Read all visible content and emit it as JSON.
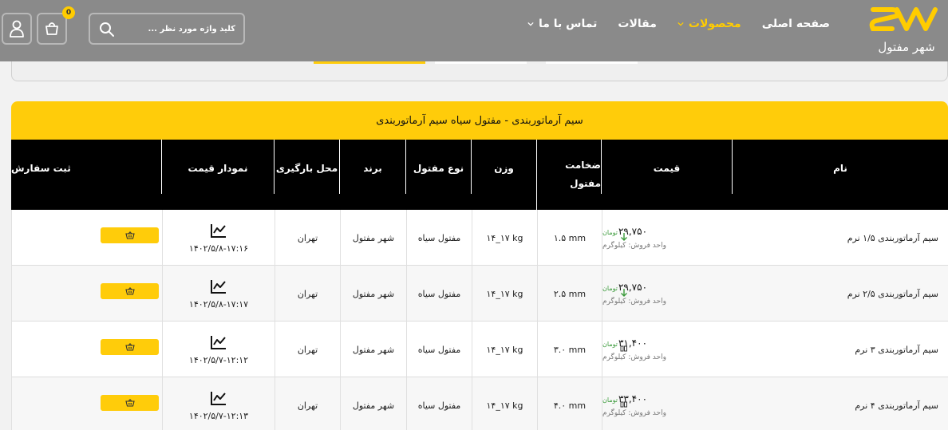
{
  "header": {
    "logo_text": "شهر مفتول",
    "nav": [
      {
        "label": "صفحه اصلی",
        "active": false,
        "has_dropdown": false
      },
      {
        "label": "محصولات",
        "active": true,
        "has_dropdown": true
      },
      {
        "label": "مقالات",
        "active": false,
        "has_dropdown": false
      },
      {
        "label": "تماس با ما",
        "active": false,
        "has_dropdown": true
      }
    ],
    "search_placeholder": "کلید واژه مورد نظر ...",
    "cart_count": "0",
    "icons": [
      "search-icon",
      "cart-icon",
      "user-icon",
      "chevron-down-icon"
    ]
  },
  "table": {
    "title": "سیم آرماتوربندی - مفتول سیاه   سیم آرماتوربندی",
    "columns": {
      "name": "نام",
      "price": "قیمت",
      "thickness_1": "ضخامت",
      "thickness_2": "مفتول",
      "weight": "وزن",
      "type": "نوع مفتول",
      "brand": "برند",
      "location": "محل بارگیری",
      "chart": "نمودار قیمت",
      "order": "ثبت سفارش"
    },
    "rows": [
      {
        "name": "سیم آرماتوربندی ۱/۵ نرم",
        "price": "۲۹,۷۵۰",
        "currency": "تومان",
        "unit": "واحد فروش: کیلوگرم",
        "trend": "down",
        "thickness": "۱.۵ mm",
        "weight": "۱۴_۱۷ kg",
        "type": "مفتول سیاه",
        "brand": "شهر مفتول",
        "location": "تهران",
        "date": "۱۴۰۲/۵/۸-۱۷:۱۶"
      },
      {
        "name": "سیم آرماتوربندی ۲/۵ نرم",
        "price": "۲۹,۷۵۰",
        "currency": "تومان",
        "unit": "واحد فروش: کیلوگرم",
        "trend": "down",
        "thickness": "۲.۵ mm",
        "weight": "۱۴_۱۷ kg",
        "type": "مفتول سیاه",
        "brand": "شهر مفتول",
        "location": "تهران",
        "date": "۱۴۰۲/۵/۸-۱۷:۱۷"
      },
      {
        "name": "سیم آرماتوربندی ۳ نرم",
        "price": "۳۱,۴۰۰",
        "currency": "تومان",
        "unit": "واحد فروش: کیلوگرم",
        "trend": "same",
        "thickness": "۳.۰ mm",
        "weight": "۱۴_۱۷ kg",
        "type": "مفتول سیاه",
        "brand": "شهر مفتول",
        "location": "تهران",
        "date": "۱۴۰۲/۵/۷-۱۲:۱۲"
      },
      {
        "name": "سیم آرماتوربندی ۴ نرم",
        "price": "۳۳,۴۰۰",
        "currency": "تومان",
        "unit": "واحد فروش: کیلوگرم",
        "trend": "same",
        "thickness": "۴.۰ mm",
        "weight": "۱۴_۱۷ kg",
        "type": "مفتول سیاه",
        "brand": "شهر مفتول",
        "location": "تهران",
        "date": "۱۴۰۲/۵/۷-۱۲:۱۳"
      }
    ]
  },
  "colors": {
    "accent": "#ffcc0a",
    "header_bg": "#8a8a8a",
    "table_head": "#000000",
    "trend_down": "#3a9a3a"
  }
}
